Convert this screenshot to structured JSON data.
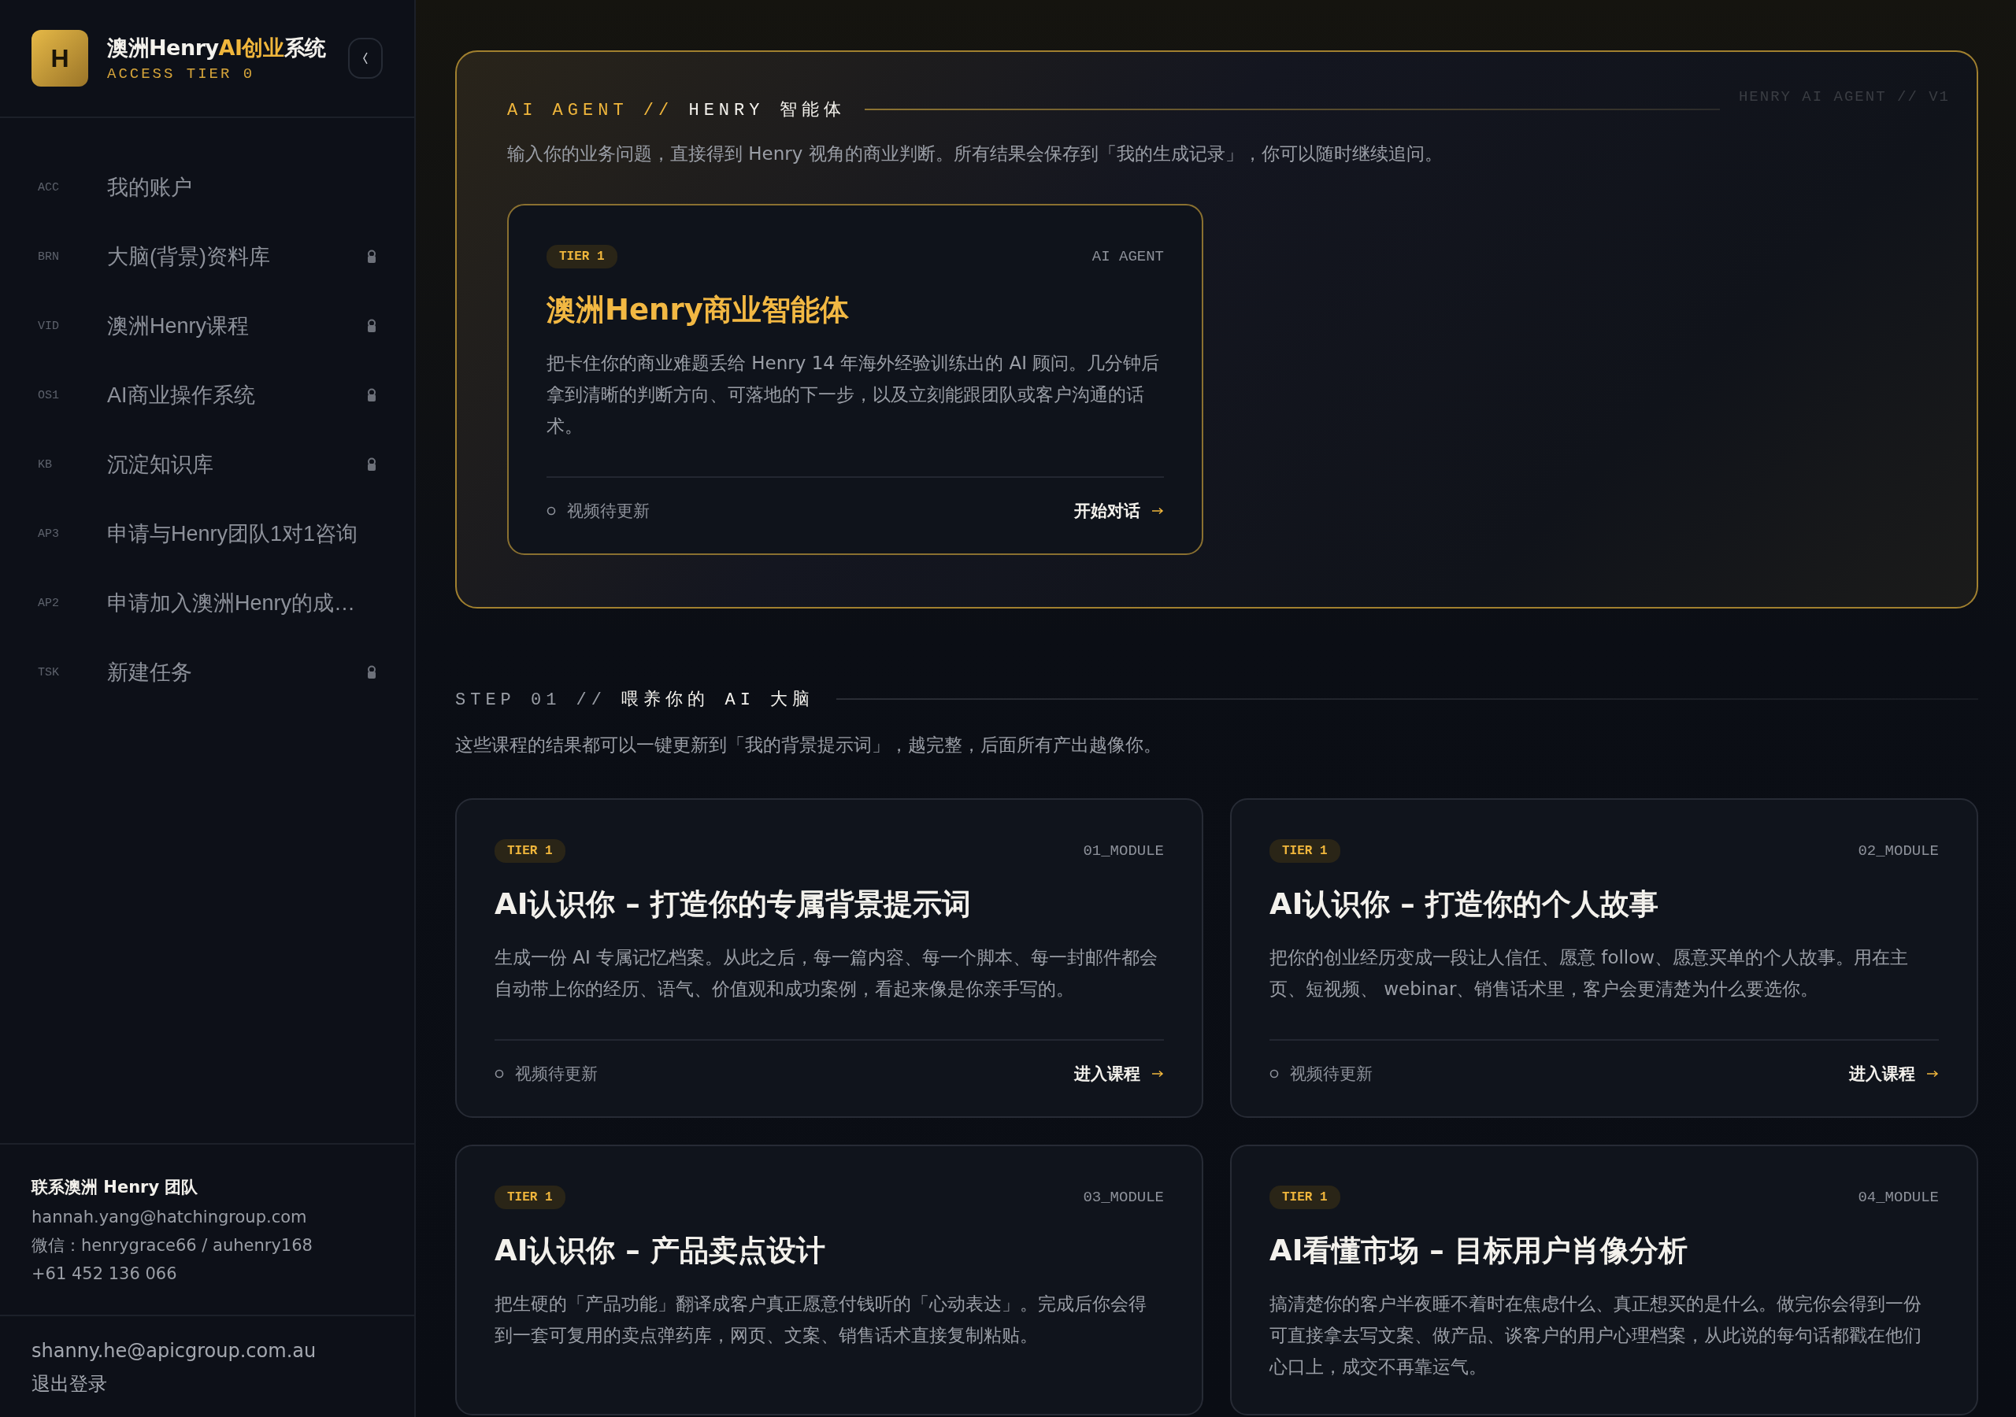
{
  "sidebar": {
    "logo": "H",
    "title": [
      {
        "text": "澳洲Henry",
        "accent": false
      },
      {
        "text": "AI创业",
        "accent": true
      },
      {
        "text": "系统",
        "accent": false
      }
    ],
    "subtitle": "ACCESS TIER 0",
    "nav": [
      {
        "code": "ACC",
        "label": "我的账户",
        "locked": false,
        "selected": false
      },
      {
        "code": "BRN",
        "label": "大脑(背景)资料库",
        "locked": true,
        "selected": false
      },
      {
        "code": "VID",
        "label": "澳洲Henry课程",
        "locked": true,
        "selected": false
      },
      {
        "code": "OS1",
        "label": "AI商业操作系统",
        "locked": true,
        "selected": false
      },
      {
        "code": "KB",
        "label": "沉淀知识库",
        "locked": true,
        "selected": false
      },
      {
        "code": "AP3",
        "label": "申请与Henry团队1对1咨询",
        "locked": false,
        "selected": false
      },
      {
        "code": "AP2",
        "label": "申请加入澳洲Henry的成…",
        "locked": false,
        "selected": false
      },
      {
        "code": "TSK",
        "label": "新建任务",
        "locked": true,
        "selected": false
      }
    ],
    "contact": {
      "title": "联系澳洲 Henry 团队",
      "lines": [
        "hannah.yang@hatchingroup.com",
        "微信：henrygrace66 / auhenry168",
        "+61 452 136 066"
      ]
    },
    "account": {
      "email": "shanny.he@apicgroup.com.au",
      "logout": "退出登录"
    }
  },
  "agent_panel": {
    "heading_accent": "AI AGENT //",
    "heading": "HENRY 智能体",
    "version": "HENRY AI AGENT // V1",
    "description": "输入你的业务问题，直接得到 Henry 视角的商业判断。所有结果会保存到「我的生成记录」，你可以随时继续追问。",
    "cards": [
      {
        "kind": "agent",
        "tier": "TIER 1",
        "tag": "AI AGENT",
        "title": "澳洲Henry商业智能体",
        "description": "把卡住你的商业难题丢给 Henry 14 年海外经验训练出的 AI 顾问。几分钟后拿到清晰的判断方向、可落地的下一步，以及立刻能跟团队或客户沟通的话术。",
        "status": "视频待更新",
        "action": "开始对话"
      }
    ]
  },
  "step": {
    "heading_accent": "STEP 01 //",
    "heading": "喂养你的 AI 大脑",
    "description": "这些课程的结果都可以一键更新到「我的背景提示词」，越完整，后面所有产出越像你。",
    "cards": [
      {
        "kind": "course",
        "tier": "TIER 1",
        "tag": "01_MODULE",
        "title": "AI认识你 – 打造你的专属背景提示词",
        "description": "生成一份 AI 专属记忆档案。从此之后，每一篇内容、每一个脚本、每一封邮件都会自动带上你的经历、语气、价值观和成功案例，看起来像是你亲手写的。",
        "status": "视频待更新",
        "action": "进入课程"
      },
      {
        "kind": "course",
        "tier": "TIER 1",
        "tag": "02_MODULE",
        "title": "AI认识你 – 打造你的个人故事",
        "description": "把你的创业经历变成一段让人信任、愿意 follow、愿意买单的个人故事。用在主页、短视频、 webinar、销售话术里，客户会更清楚为什么要选你。",
        "status": "视频待更新",
        "action": "进入课程"
      },
      {
        "kind": "course",
        "tier": "TIER 1",
        "tag": "03_MODULE",
        "title": "AI认识你 – 产品卖点设计",
        "description": "把生硬的「产品功能」翻译成客户真正愿意付钱听的「心动表达」。完成后你会得到一套可复用的卖点弹药库，网页、文案、销售话术直接复制粘贴。"
      },
      {
        "kind": "course",
        "tier": "TIER 1",
        "tag": "04_MODULE",
        "title": "AI看懂市场 – 目标用户肖像分析",
        "description": "搞清楚你的客户半夜睡不着时在焦虑什么、真正想买的是什么。做完你会得到一份可直接拿去写文案、做产品、谈客户的用户心理档案，从此说的每句话都戳在他们心口上，成交不再靠运气。"
      }
    ]
  }
}
